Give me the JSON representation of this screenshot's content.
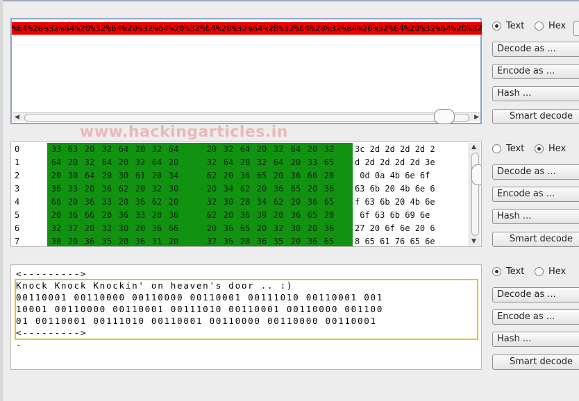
{
  "panel1": {
    "encoded_line": "%64%20%32%64%20%32%64%20%32%64%20%32%64%20%32%64%20%32%64%20%32%64%20%32%64%20%32%64%20%32%"
  },
  "watermark": "www.hackingarticles.in",
  "panel2": {
    "rows": [
      {
        "index": "0",
        "bytes": [
          "33",
          "63",
          "20",
          "32",
          "64",
          "20",
          "32",
          "64",
          "20",
          "32",
          "64",
          "20",
          "32",
          "64",
          "20",
          "32"
        ],
        "ascii": "3c 2d 2d 2d 2d 2"
      },
      {
        "index": "1",
        "bytes": [
          "64",
          "20",
          "32",
          "64",
          "20",
          "32",
          "64",
          "20",
          "32",
          "64",
          "20",
          "32",
          "64",
          "20",
          "33",
          "65"
        ],
        "ascii": "d 2d 2d 2d 2d 3e"
      },
      {
        "index": "2",
        "bytes": [
          "20",
          "30",
          "64",
          "20",
          "30",
          "61",
          "20",
          "34",
          "62",
          "20",
          "36",
          "65",
          "20",
          "36",
          "66",
          "20"
        ],
        "ascii": " 0d 0a 4b 6e 6f"
      },
      {
        "index": "3",
        "bytes": [
          "36",
          "33",
          "20",
          "36",
          "62",
          "20",
          "32",
          "30",
          "20",
          "34",
          "62",
          "20",
          "36",
          "65",
          "20",
          "36"
        ],
        "ascii": "63 6b 20 4b 6e 6"
      },
      {
        "index": "4",
        "bytes": [
          "66",
          "20",
          "36",
          "33",
          "20",
          "36",
          "62",
          "20",
          "32",
          "30",
          "20",
          "34",
          "62",
          "20",
          "36",
          "65"
        ],
        "ascii": "f 63 6b 20 4b 6e"
      },
      {
        "index": "5",
        "bytes": [
          "20",
          "36",
          "66",
          "20",
          "36",
          "33",
          "20",
          "36",
          "62",
          "20",
          "36",
          "39",
          "20",
          "36",
          "65",
          "20"
        ],
        "ascii": " 6f 63 6b 69 6e"
      },
      {
        "index": "6",
        "bytes": [
          "32",
          "37",
          "20",
          "32",
          "30",
          "20",
          "36",
          "66",
          "20",
          "36",
          "65",
          "20",
          "32",
          "30",
          "20",
          "36"
        ],
        "ascii": "27 20 6f 6e 20 6"
      },
      {
        "index": "7",
        "bytes": [
          "38",
          "20",
          "36",
          "35",
          "20",
          "36",
          "31",
          "20",
          "37",
          "36",
          "20",
          "36",
          "35",
          "20",
          "36",
          "65"
        ],
        "ascii": "8 65 61 76 65 6e"
      }
    ]
  },
  "panel3": {
    "lines": [
      "<--------->",
      "Knock Knock Knockin' on heaven's door .. :)",
      "00110001 00110000 00110000 00110001 00111010 00110001 001",
      "10001 00110000 00110001 00111010 00110001 00110000 001100",
      "01 00110001 00111010 00110001 00110000 00110000 00110001",
      "<--------->",
      "-"
    ]
  },
  "controls": [
    {
      "text_label": "Text",
      "hex_label": "Hex",
      "selected": "Text",
      "decode": "Decode as ...",
      "encode": "Encode as ...",
      "hash": "Hash ...",
      "smart": "Smart decode"
    },
    {
      "text_label": "Text",
      "hex_label": "Hex",
      "selected": "Hex",
      "decode": "Decode as ...",
      "encode": "Encode as ...",
      "hash": "Hash ...",
      "smart": "Smart decode"
    },
    {
      "text_label": "Text",
      "hex_label": "Hex",
      "selected": "Text",
      "decode": "Decode as ...",
      "encode": "Encode as ...",
      "hash": "Hash ...",
      "smart": "Smart decode"
    }
  ]
}
